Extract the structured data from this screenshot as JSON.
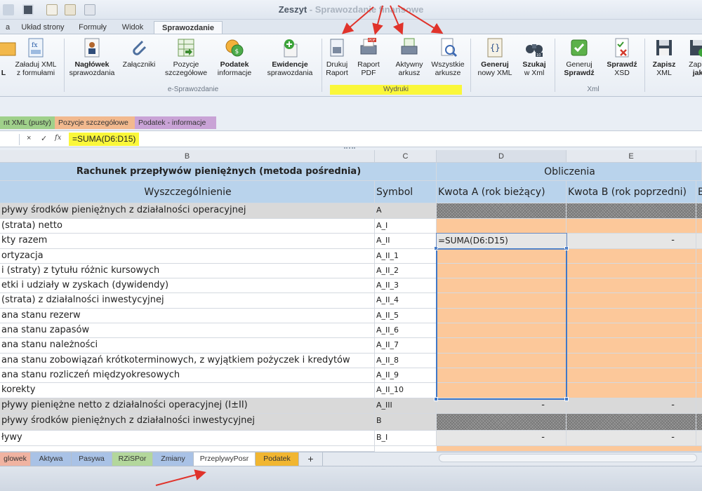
{
  "window": {
    "title_main": "Zeszyt",
    "title_rest": " - Sprawozdanie finansowe"
  },
  "ribbon_tabs": [
    {
      "label": "a"
    },
    {
      "label": "Układ strony"
    },
    {
      "label": "Formuły"
    },
    {
      "label": "Widok"
    },
    {
      "label": "Sprawozdanie"
    }
  ],
  "ribbon_buttons": [
    {
      "line1": "",
      "line2": "L"
    },
    {
      "line1": "Załaduj XML",
      "line2": "z formułami"
    },
    {
      "line1": "Nagłówek",
      "line2": "sprawozdania"
    },
    {
      "line1": "Załączniki",
      "line2": ""
    },
    {
      "line1": "Pozycje",
      "line2": "szczegółowe"
    },
    {
      "line1": "Podatek",
      "line2": "informacje"
    },
    {
      "line1": "Ewidencje",
      "line2": "sprawozdania"
    },
    {
      "line1": "Drukuj",
      "line2": "Raport"
    },
    {
      "line1": "Raport",
      "line2": "PDF"
    },
    {
      "line1": "Aktywny",
      "line2": "arkusz"
    },
    {
      "line1": "Wszystkie",
      "line2": "arkusze"
    },
    {
      "line1": "Generuj",
      "line2": "nowy XML"
    },
    {
      "line1": "Szukaj",
      "line2": "w Xml"
    },
    {
      "line1": "Generuj",
      "line2": "Sprawdź"
    },
    {
      "line1": "Sprawdź",
      "line2": "XSD"
    },
    {
      "line1": "Zapisz",
      "line2": "XML"
    },
    {
      "line1": "Zapis",
      "line2": "jak"
    }
  ],
  "ribbon_groups": [
    {
      "label": "e-Sprawozdanie"
    },
    {
      "label": "Wydruki"
    },
    {
      "label": "Xml"
    }
  ],
  "sheet_strip_tabs": [
    {
      "label": "nt XML (pusty)"
    },
    {
      "label": "Pozycje szczegółowe"
    },
    {
      "label": "Podatek - informacje"
    }
  ],
  "formula_bar": {
    "cancel": "×",
    "confirm": "✓",
    "fx": "fx",
    "formula": "=SUMA(D6:D15)"
  },
  "columns": [
    {
      "label": "B"
    },
    {
      "label": "C"
    },
    {
      "label": "D"
    },
    {
      "label": "E"
    }
  ],
  "table": {
    "title": "Rachunek przepływów pieniężnych (metoda pośrednia)",
    "obliczenia": "Obliczenia",
    "head_desc": "Wyszczególnienie",
    "head_symbol": "Symbol",
    "head_a": "Kwota A (rok bieżący)",
    "head_b": "Kwota B (rok poprzedni)",
    "head_f": "B",
    "rows": [
      {
        "desc": "pływy środków pieniężnych z działalności operacyjnej",
        "symbol": "A",
        "d": "",
        "e": ""
      },
      {
        "desc": "(strata) netto",
        "symbol": "A_I",
        "d": "",
        "e": ""
      },
      {
        "desc": "kty razem",
        "symbol": "A_II",
        "d": "=SUMA(D6:D15)",
        "e": "-"
      },
      {
        "desc": "ortyzacja",
        "symbol": "A_II_1",
        "d": "",
        "e": ""
      },
      {
        "desc": "i (straty) z tytułu różnic kursowych",
        "symbol": "A_II_2",
        "d": "",
        "e": ""
      },
      {
        "desc": "etki i udziały w zyskach (dywidendy)",
        "symbol": "A_II_3",
        "d": "",
        "e": ""
      },
      {
        "desc": "(strata) z działalności inwestycyjnej",
        "symbol": "A_II_4",
        "d": "",
        "e": ""
      },
      {
        "desc": "ana stanu rezerw",
        "symbol": "A_II_5",
        "d": "",
        "e": ""
      },
      {
        "desc": "ana stanu zapasów",
        "symbol": "A_II_6",
        "d": "",
        "e": ""
      },
      {
        "desc": "ana stanu należności",
        "symbol": "A_II_7",
        "d": "",
        "e": ""
      },
      {
        "desc": "ana stanu zobowiązań krótkoterminowych, z wyjątkiem pożyczek i kredytów",
        "symbol": "A_II_8",
        "d": "",
        "e": ""
      },
      {
        "desc": "ana stanu rozliczeń międzyokresowych",
        "symbol": "A_II_9",
        "d": "",
        "e": ""
      },
      {
        "desc": "korekty",
        "symbol": "A_II_10",
        "d": "",
        "e": ""
      },
      {
        "desc": "pływy pieniężne netto z działalności operacyjnej (I±II)",
        "symbol": "A_III",
        "d": "-",
        "e": "-"
      },
      {
        "desc": "pływy środków pieniężnych z działalności inwestycyjnej",
        "symbol": "B",
        "d": "",
        "e": ""
      },
      {
        "desc": "ływy",
        "symbol": "B_I",
        "d": "-",
        "e": "-"
      }
    ]
  },
  "sheet_tabs": [
    {
      "label": "glowek"
    },
    {
      "label": "Aktywa"
    },
    {
      "label": "Pasywa"
    },
    {
      "label": "RZiSPor"
    },
    {
      "label": "Zmiany"
    },
    {
      "label": "PrzeplywyPosr"
    },
    {
      "label": "Podatek"
    },
    {
      "label": "+"
    }
  ],
  "colors": {
    "highlight": "#faf73a",
    "orange_cell": "#fcc89a",
    "header_blue": "#b9d3ec",
    "selection": "#3f78c8",
    "arrow": "#e0332b"
  }
}
